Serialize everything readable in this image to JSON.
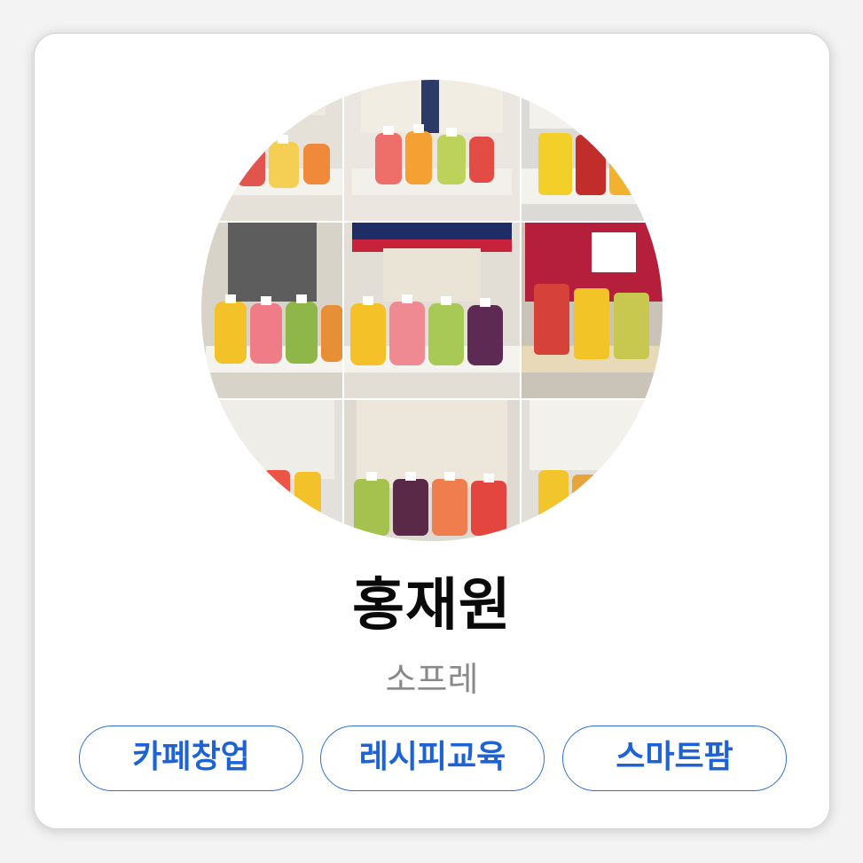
{
  "profile": {
    "name": "홍재원",
    "subtitle": "소프레"
  },
  "tags": [
    {
      "label": "카페창업"
    },
    {
      "label": "레시피교육"
    },
    {
      "label": "스마트팜"
    }
  ],
  "colors": {
    "accent": "#1e63d6",
    "name_text": "#0a0a0a",
    "subtitle_text": "#8a8a8a",
    "card_background": "#ffffff"
  },
  "avatar": {
    "icon": "profile-photo-collage"
  }
}
